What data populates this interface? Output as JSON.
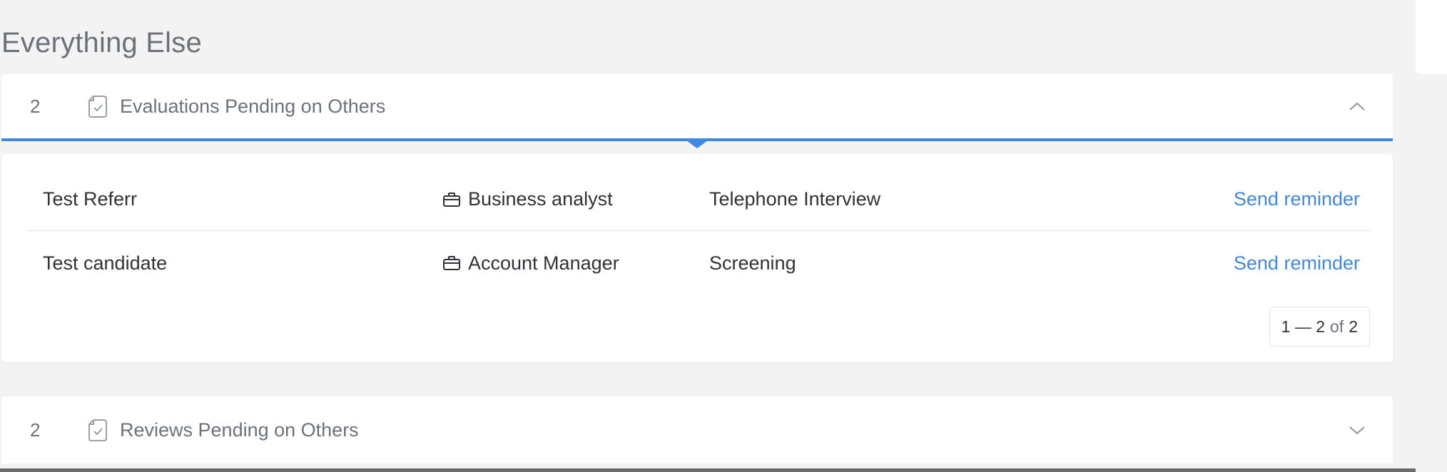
{
  "section": {
    "title": "Everything Else"
  },
  "panels": [
    {
      "count": "2",
      "title": "Evaluations Pending on Others",
      "expanded": true,
      "icon": "document-check-icon",
      "chevron_icon": "chevron-up-icon",
      "rows": [
        {
          "name": "Test Referr",
          "job": "Business analyst",
          "stage": "Telephone Interview",
          "action": "Send reminder"
        },
        {
          "name": "Test candidate",
          "job": "Account Manager",
          "stage": "Screening",
          "action": "Send reminder"
        }
      ],
      "pagination": {
        "range": "1 — 2",
        "of_label": "of",
        "total": "2"
      }
    },
    {
      "count": "2",
      "title": "Reviews Pending on Others",
      "expanded": false,
      "icon": "document-check-icon",
      "chevron_icon": "chevron-down-icon"
    }
  ],
  "colors": {
    "accent": "#3f88e3",
    "muted_text": "#6c727a",
    "background": "#f3f3f3"
  }
}
